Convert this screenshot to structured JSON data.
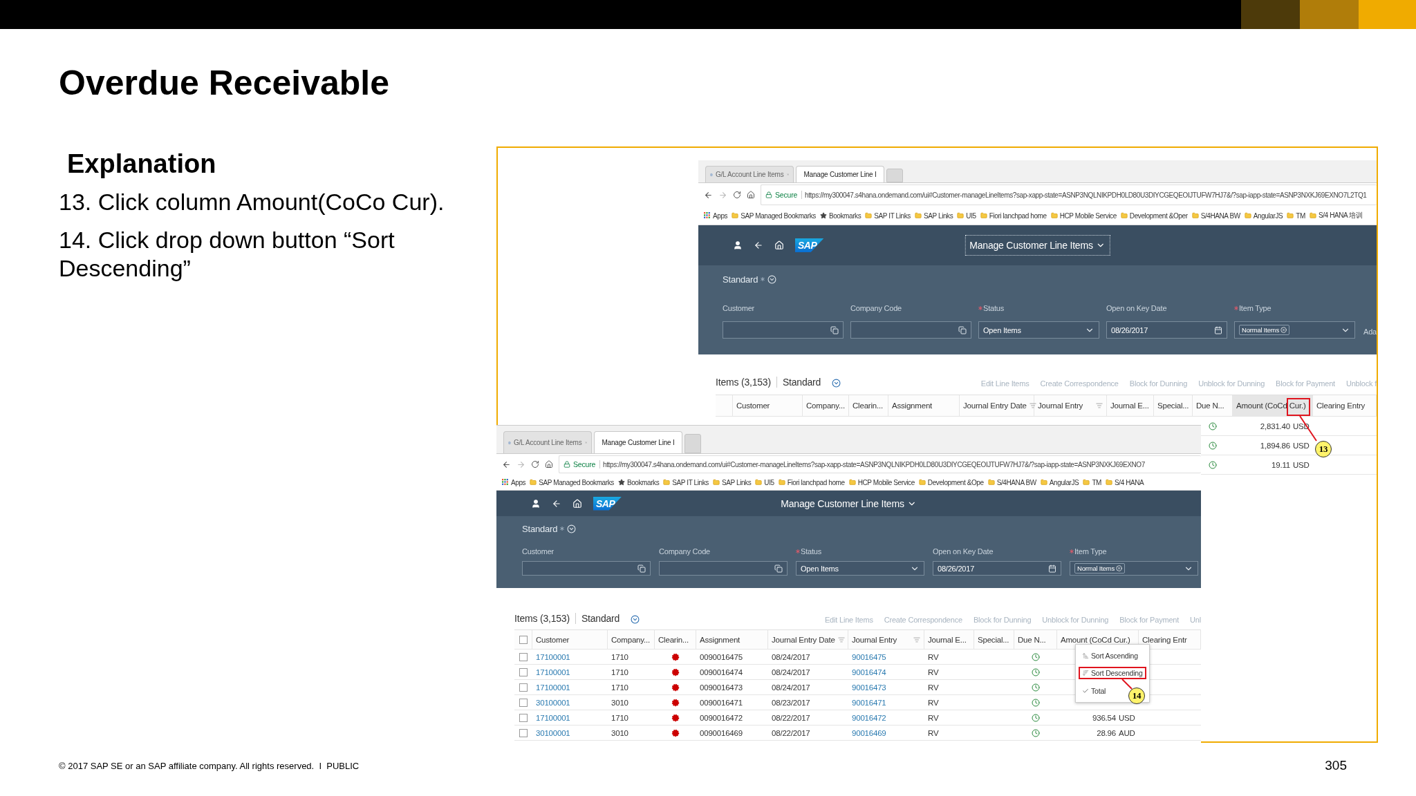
{
  "slide": {
    "title": "Overdue Receivable",
    "section": "Explanation",
    "steps": [
      "13. Click column Amount(CoCo Cur).",
      "14. Click drop down button “Sort Descending”"
    ],
    "footer": "© 2017 SAP SE or an SAP affiliate company. All rights reserved.  I  PUBLIC",
    "page_number": "305"
  },
  "screenshots": [
    {
      "tabs": [
        {
          "label": "G/L Account Line Items",
          "selected": false
        },
        {
          "label": "Manage Customer Line I",
          "selected": true
        }
      ],
      "address": {
        "security": "Secure",
        "url": "https://my300047.s4hana.ondemand.com/ui#Customer-manageLineItems?sap-xapp-state=ASNP3NQLNIKPDH0LD80U3DIYCGEQEOIJTUFW7HJ7&/?sap-iapp-state=ASNP3NXKJ69EXNO7L2TQ1"
      },
      "bookmarks": [
        {
          "kind": "apps",
          "label": "Apps"
        },
        {
          "kind": "folder",
          "label": "SAP Managed Bookmarks"
        },
        {
          "kind": "star",
          "label": "Bookmarks"
        },
        {
          "kind": "folder",
          "label": "SAP IT Links"
        },
        {
          "kind": "folder",
          "label": "SAP Links"
        },
        {
          "kind": "folder",
          "label": "UI5"
        },
        {
          "kind": "folder",
          "label": "Fiori lanchpad home"
        },
        {
          "kind": "folder",
          "label": "HCP  Mobile Service"
        },
        {
          "kind": "folder",
          "label": "Development &Oper"
        },
        {
          "kind": "folder",
          "label": "S/4HANA BW"
        },
        {
          "kind": "folder",
          "label": "AngularJS"
        },
        {
          "kind": "folder",
          "label": "TM"
        },
        {
          "kind": "folder",
          "label": "S/4 HANA 培训"
        }
      ],
      "shell": {
        "logo": "SAP",
        "title": "Manage Customer Line Items",
        "focused": true
      },
      "variant": {
        "label": "Standard",
        "modified": true
      },
      "filters": [
        {
          "label": "Customer",
          "required": false,
          "kind": "valuehelp"
        },
        {
          "label": "Company Code",
          "required": false,
          "kind": "valuehelp"
        },
        {
          "label": "Status",
          "required": true,
          "kind": "select",
          "value": "Open Items"
        },
        {
          "label": "Open on Key Date",
          "required": false,
          "kind": "date",
          "value": "08/26/2017"
        },
        {
          "label": "Item Type",
          "required": true,
          "kind": "token",
          "value": "Normal Items"
        }
      ],
      "filter_overflow": "Ada",
      "items": {
        "title": "Items (3,153)",
        "variant": "Standard",
        "actions": [
          "Edit Line Items",
          "Create Correspondence",
          "Block for Dunning",
          "Unblock for Dunning",
          "Block for Payment",
          "Unblock f"
        ]
      },
      "columns": [
        {
          "label": "Customer",
          "filtered": false,
          "selected": false
        },
        {
          "label": "Company...",
          "filtered": false,
          "selected": false
        },
        {
          "label": "Clearin...",
          "filtered": false,
          "selected": false
        },
        {
          "label": "Assignment",
          "filtered": false,
          "selected": false
        },
        {
          "label": "Journal Entry Date",
          "filtered": true,
          "selected": false
        },
        {
          "label": "Journal Entry",
          "filtered": true,
          "selected": false
        },
        {
          "label": "Journal E...",
          "filtered": false,
          "selected": false
        },
        {
          "label": "Special...",
          "filtered": false,
          "selected": false
        },
        {
          "label": "Due N...",
          "filtered": false,
          "selected": false
        },
        {
          "label": "Amount (CoCd Cur.)",
          "filtered": false,
          "selected": true
        },
        {
          "label": "Clearing Entry",
          "filtered": false,
          "selected": false
        }
      ],
      "rows": [
        {
          "overdue": true,
          "amount": "2,831.40",
          "currency": "USD"
        },
        {
          "overdue": true,
          "amount": "1,894.86",
          "currency": "USD"
        },
        {
          "overdue": true,
          "amount": "19.11",
          "currency": "USD"
        }
      ],
      "callout": "13"
    },
    {
      "tabs": [
        {
          "label": "G/L Account Line Items",
          "selected": false
        },
        {
          "label": "Manage Customer Line I",
          "selected": true
        }
      ],
      "address": {
        "security": "Secure",
        "url": "https://my300047.s4hana.ondemand.com/ui#Customer-manageLineItems?sap-xapp-state=ASNP3NQLNIKPDH0LD80U3DIYCGEQEOIJTUFW7HJ7&/?sap-iapp-state=ASNP3NXKJ69EXNO7"
      },
      "bookmarks": [
        {
          "kind": "apps",
          "label": "Apps"
        },
        {
          "kind": "folder",
          "label": "SAP Managed Bookmarks"
        },
        {
          "kind": "star",
          "label": "Bookmarks"
        },
        {
          "kind": "folder",
          "label": "SAP IT Links"
        },
        {
          "kind": "folder",
          "label": "SAP Links"
        },
        {
          "kind": "folder",
          "label": "UI5"
        },
        {
          "kind": "folder",
          "label": "Fiori lanchpad home"
        },
        {
          "kind": "folder",
          "label": "HCP  Mobile Service"
        },
        {
          "kind": "folder",
          "label": "Development &Ope"
        },
        {
          "kind": "folder",
          "label": "S/4HANA BW"
        },
        {
          "kind": "folder",
          "label": "AngularJS"
        },
        {
          "kind": "folder",
          "label": "TM"
        },
        {
          "kind": "folder",
          "label": "S/4 HANA"
        }
      ],
      "shell": {
        "logo": "SAP",
        "title": "Manage Customer Line Items",
        "focused": false
      },
      "variant": {
        "label": "Standard",
        "modified": true
      },
      "filters": [
        {
          "label": "Customer",
          "required": false,
          "kind": "valuehelp"
        },
        {
          "label": "Company Code",
          "required": false,
          "kind": "valuehelp"
        },
        {
          "label": "Status",
          "required": true,
          "kind": "select",
          "value": "Open Items"
        },
        {
          "label": "Open on Key Date",
          "required": false,
          "kind": "date",
          "value": "08/26/2017"
        },
        {
          "label": "Item Type",
          "required": true,
          "kind": "token",
          "value": "Normal Items"
        }
      ],
      "items": {
        "title": "Items (3,153)",
        "variant": "Standard",
        "actions": [
          "Edit Line Items",
          "Create Correspondence",
          "Block for Dunning",
          "Unblock for Dunning",
          "Block for Payment",
          "Unl"
        ]
      },
      "all_checked": false,
      "columns": [
        {
          "label": "Customer",
          "filtered": false,
          "selected": false
        },
        {
          "label": "Company...",
          "filtered": false,
          "selected": false
        },
        {
          "label": "Clearin...",
          "filtered": false,
          "selected": false
        },
        {
          "label": "Assignment",
          "filtered": false,
          "selected": false
        },
        {
          "label": "Journal Entry Date",
          "filtered": true,
          "selected": false
        },
        {
          "label": "Journal Entry",
          "filtered": true,
          "selected": false
        },
        {
          "label": "Journal E...",
          "filtered": false,
          "selected": false
        },
        {
          "label": "Special...",
          "filtered": false,
          "selected": false
        },
        {
          "label": "Due N...",
          "filtered": false,
          "selected": false
        },
        {
          "label": "Amount (CoCd Cur.)",
          "filtered": false,
          "selected": false
        },
        {
          "label": "Clearing Entr",
          "filtered": false,
          "selected": false
        }
      ],
      "rows": [
        {
          "checked": false,
          "customer": "17100001",
          "company": "1710",
          "cleared": false,
          "assignment": "0090016475",
          "date": "08/24/2017",
          "journal_entry": "90016475",
          "entry_type": "RV",
          "overdue": true
        },
        {
          "checked": false,
          "customer": "17100001",
          "company": "1710",
          "cleared": false,
          "assignment": "0090016474",
          "date": "08/24/2017",
          "journal_entry": "90016474",
          "entry_type": "RV",
          "overdue": true
        },
        {
          "checked": false,
          "customer": "17100001",
          "company": "1710",
          "cleared": false,
          "assignment": "0090016473",
          "date": "08/24/2017",
          "journal_entry": "90016473",
          "entry_type": "RV",
          "overdue": true
        },
        {
          "checked": false,
          "customer": "30100001",
          "company": "3010",
          "cleared": false,
          "assignment": "0090016471",
          "date": "08/23/2017",
          "journal_entry": "90016471",
          "entry_type": "RV",
          "overdue": true
        },
        {
          "checked": false,
          "customer": "17100001",
          "company": "1710",
          "cleared": false,
          "assignment": "0090016472",
          "date": "08/22/2017",
          "journal_entry": "90016472",
          "entry_type": "RV",
          "overdue": true,
          "amount": "936.54",
          "currency": "USD"
        },
        {
          "checked": false,
          "customer": "30100001",
          "company": "3010",
          "cleared": false,
          "assignment": "0090016469",
          "date": "08/22/2017",
          "journal_entry": "90016469",
          "entry_type": "RV",
          "overdue": true,
          "amount": "28.96",
          "currency": "AUD"
        }
      ],
      "menu": [
        {
          "kind": "ascending",
          "label": "Sort Ascending",
          "highlighted": false
        },
        {
          "kind": "descending",
          "label": "Sort Descending",
          "highlighted": true
        },
        {
          "kind": "check",
          "label": "Total",
          "highlighted": false
        }
      ],
      "callout": "14"
    }
  ]
}
